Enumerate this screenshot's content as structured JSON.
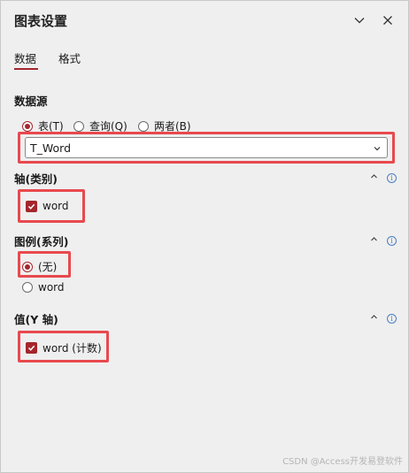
{
  "pane": {
    "title": "图表设置",
    "tabs": [
      {
        "label": "数据",
        "active": true
      },
      {
        "label": "格式",
        "active": false
      }
    ]
  },
  "data_source": {
    "title": "数据源",
    "options": [
      {
        "label": "表(T)",
        "selected": true
      },
      {
        "label": "查询(Q)",
        "selected": false
      },
      {
        "label": "两者(B)",
        "selected": false
      }
    ],
    "selected_value": "T_Word"
  },
  "axis": {
    "title": "轴(类别)",
    "fields": [
      {
        "label": "word",
        "checked": true
      }
    ]
  },
  "legend": {
    "title": "图例(系列)",
    "options": [
      {
        "label": "(无)",
        "selected": true
      },
      {
        "label": "word",
        "selected": false
      }
    ]
  },
  "values": {
    "title": "值(Y 轴)",
    "fields": [
      {
        "label": "word (计数)",
        "checked": true
      }
    ]
  },
  "watermark": "CSDN @Access开发易登软件",
  "colors": {
    "accent": "#a4262c",
    "highlight": "#e8494e",
    "info": "#4a7fc1"
  }
}
